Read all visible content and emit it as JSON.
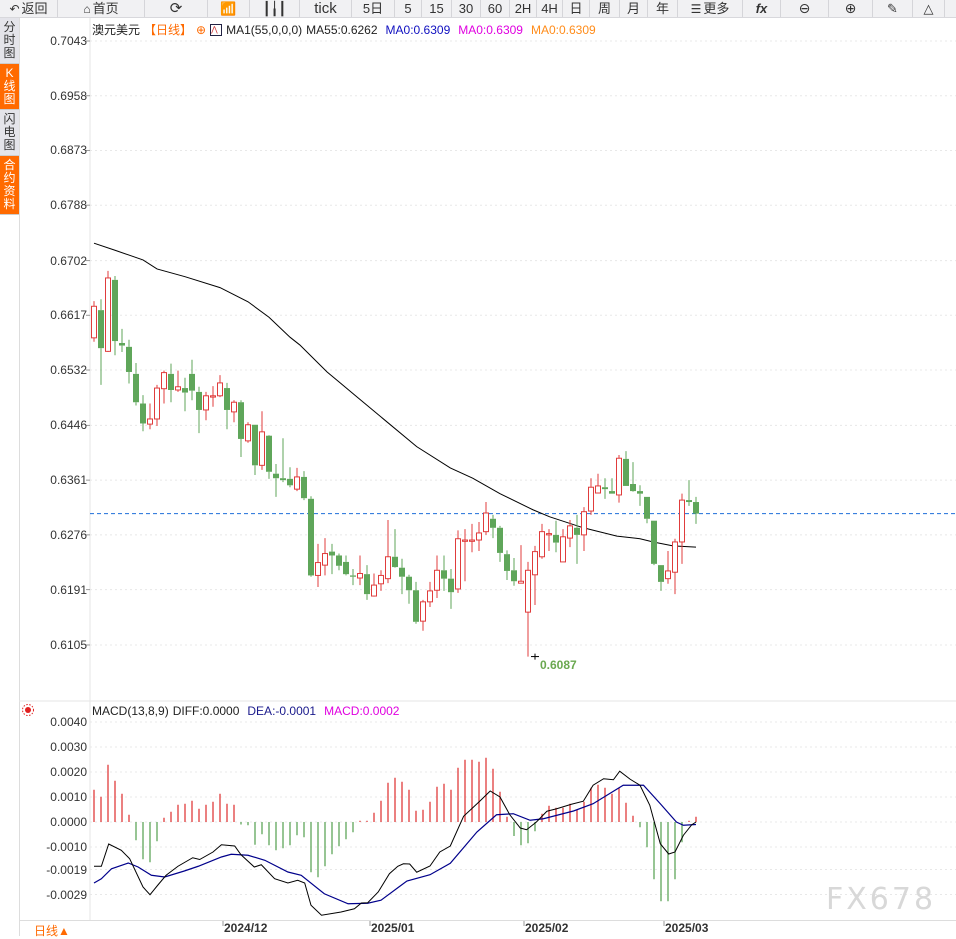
{
  "toolbar": {
    "back": "返回",
    "home": "首页",
    "tick": "tick",
    "five_day": "5日",
    "periods": [
      "5",
      "15",
      "30",
      "60",
      "2H",
      "4H",
      "日",
      "周",
      "月",
      "年"
    ],
    "more": "更多"
  },
  "sidebar": {
    "tabs": [
      "分时图",
      "K线图",
      "闪电图",
      "合约资料"
    ]
  },
  "legend": {
    "symbol": "澳元美元",
    "period": "【日线】",
    "ma_name": "MA1(55,0,0,0)",
    "ma55": "MA55:0.6262",
    "ma0_a": "MA0:0.6309",
    "ma0_b": "MA0:0.6309",
    "ma0_c": "MA0:0.6309"
  },
  "macd_legend": {
    "name": "MACD(13,8,9)",
    "diff": "DIFF:0.0000",
    "dea": "DEA:-0.0001",
    "macd": "MACD:0.0002"
  },
  "bottom": {
    "period": "日线▲"
  },
  "watermark": "FX678",
  "colors": {
    "up": "#e03c3c",
    "down": "#5fa65a",
    "accent": "#ff6a00",
    "dea": "#00008b",
    "macd_text": "#e000e0",
    "last_line": "#1e6fd9"
  },
  "chart_data": [
    {
      "type": "candlestick",
      "title": "澳元美元 日线",
      "y_ticks": [
        "0.7043",
        "0.6958",
        "0.6873",
        "0.6788",
        "0.6702",
        "0.6617",
        "0.6532",
        "0.6446",
        "0.6361",
        "0.6276",
        "0.6191",
        "0.6105"
      ],
      "ylim": [
        0.6105,
        0.7043
      ],
      "x_ticks": [
        {
          "label": "2024/12",
          "index": 19
        },
        {
          "label": "2025/01",
          "index": 40
        },
        {
          "label": "2025/02",
          "index": 62
        },
        {
          "label": "2025/03",
          "index": 82
        }
      ],
      "last_price": 0.6309,
      "low_marker": {
        "index": 63,
        "value": 0.6087,
        "label": "0.6087"
      },
      "candles_ohlc": [
        [
          0.6582,
          0.6639,
          0.6576,
          0.6631
        ],
        [
          0.6625,
          0.6642,
          0.6509,
          0.6566
        ],
        [
          0.6561,
          0.6686,
          0.656,
          0.6675
        ],
        [
          0.6672,
          0.6678,
          0.6555,
          0.6577
        ],
        [
          0.6574,
          0.6596,
          0.656,
          0.657
        ],
        [
          0.6568,
          0.6579,
          0.6511,
          0.6529
        ],
        [
          0.6526,
          0.6543,
          0.6477,
          0.6482
        ],
        [
          0.648,
          0.6493,
          0.6437,
          0.6449
        ],
        [
          0.6448,
          0.648,
          0.644,
          0.6456
        ],
        [
          0.6456,
          0.6509,
          0.6445,
          0.6504
        ],
        [
          0.6503,
          0.6531,
          0.648,
          0.6528
        ],
        [
          0.6526,
          0.6542,
          0.6482,
          0.6501
        ],
        [
          0.6501,
          0.6531,
          0.6498,
          0.6506
        ],
        [
          0.6504,
          0.652,
          0.6468,
          0.6497
        ],
        [
          0.6526,
          0.6548,
          0.6485,
          0.65
        ],
        [
          0.6498,
          0.6506,
          0.6434,
          0.647
        ],
        [
          0.647,
          0.6498,
          0.6454,
          0.6492
        ],
        [
          0.649,
          0.6507,
          0.6475,
          0.6492
        ],
        [
          0.6492,
          0.6524,
          0.649,
          0.6512
        ],
        [
          0.6504,
          0.6512,
          0.644,
          0.647
        ],
        [
          0.6467,
          0.6485,
          0.6451,
          0.6482
        ],
        [
          0.6482,
          0.6485,
          0.6397,
          0.6425
        ],
        [
          0.6422,
          0.6451,
          0.6419,
          0.6447
        ],
        [
          0.6447,
          0.6447,
          0.6369,
          0.6384
        ],
        [
          0.6384,
          0.6468,
          0.6377,
          0.6436
        ],
        [
          0.643,
          0.6431,
          0.6363,
          0.6374
        ],
        [
          0.6371,
          0.6386,
          0.6335,
          0.6364
        ],
        [
          0.6364,
          0.6426,
          0.6358,
          0.6361
        ],
        [
          0.6363,
          0.6381,
          0.635,
          0.6353
        ],
        [
          0.6347,
          0.638,
          0.6344,
          0.6366
        ],
        [
          0.6366,
          0.6375,
          0.633,
          0.6333
        ],
        [
          0.6332,
          0.6336,
          0.6211,
          0.6213
        ],
        [
          0.6213,
          0.6262,
          0.6195,
          0.6233
        ],
        [
          0.6229,
          0.6271,
          0.6213,
          0.6247
        ],
        [
          0.625,
          0.6262,
          0.6215,
          0.6244
        ],
        [
          0.6244,
          0.6247,
          0.6221,
          0.6228
        ],
        [
          0.6234,
          0.6244,
          0.6213,
          0.6215
        ],
        [
          0.6213,
          0.6223,
          0.6198,
          0.6211
        ],
        [
          0.6209,
          0.6244,
          0.6198,
          0.6216
        ],
        [
          0.6215,
          0.6229,
          0.6175,
          0.6184
        ],
        [
          0.6181,
          0.6216,
          0.618,
          0.6198
        ],
        [
          0.62,
          0.6221,
          0.6189,
          0.6213
        ],
        [
          0.6208,
          0.6299,
          0.6201,
          0.6242
        ],
        [
          0.6242,
          0.6285,
          0.6225,
          0.6226
        ],
        [
          0.6225,
          0.6239,
          0.6184,
          0.6211
        ],
        [
          0.6211,
          0.6214,
          0.6169,
          0.619
        ],
        [
          0.619,
          0.6203,
          0.6138,
          0.6141
        ],
        [
          0.6142,
          0.6175,
          0.6127,
          0.6172
        ],
        [
          0.6172,
          0.6203,
          0.6164,
          0.6189
        ],
        [
          0.619,
          0.6244,
          0.6178,
          0.6221
        ],
        [
          0.6221,
          0.6244,
          0.6189,
          0.6208
        ],
        [
          0.6208,
          0.6223,
          0.6161,
          0.6187
        ],
        [
          0.6192,
          0.6283,
          0.6186,
          0.627
        ],
        [
          0.6266,
          0.6285,
          0.6204,
          0.6268
        ],
        [
          0.6266,
          0.6293,
          0.6249,
          0.6268
        ],
        [
          0.6268,
          0.6296,
          0.6251,
          0.6279
        ],
        [
          0.6281,
          0.6327,
          0.6276,
          0.631
        ],
        [
          0.6301,
          0.6307,
          0.6271,
          0.6287
        ],
        [
          0.6287,
          0.629,
          0.6234,
          0.6248
        ],
        [
          0.6246,
          0.6252,
          0.6206,
          0.622
        ],
        [
          0.6221,
          0.624,
          0.6197,
          0.6204
        ],
        [
          0.6201,
          0.626,
          0.6201,
          0.6204
        ],
        [
          0.6156,
          0.6234,
          0.6087,
          0.6221
        ],
        [
          0.6214,
          0.6259,
          0.6167,
          0.625
        ],
        [
          0.6242,
          0.6293,
          0.6239,
          0.6281
        ],
        [
          0.6276,
          0.6285,
          0.6251,
          0.6278
        ],
        [
          0.6276,
          0.6298,
          0.6249,
          0.6264
        ],
        [
          0.6234,
          0.6285,
          0.6234,
          0.6273
        ],
        [
          0.6271,
          0.6299,
          0.6257,
          0.629
        ],
        [
          0.6287,
          0.6307,
          0.6231,
          0.6276
        ],
        [
          0.6276,
          0.6319,
          0.6251,
          0.6312
        ],
        [
          0.6313,
          0.6364,
          0.6307,
          0.635
        ],
        [
          0.6341,
          0.6371,
          0.6341,
          0.6352
        ],
        [
          0.635,
          0.6364,
          0.6332,
          0.6347
        ],
        [
          0.6344,
          0.6364,
          0.634,
          0.634
        ],
        [
          0.6338,
          0.64,
          0.6326,
          0.6395
        ],
        [
          0.6394,
          0.6406,
          0.6352,
          0.6352
        ],
        [
          0.6355,
          0.6389,
          0.6343,
          0.6344
        ],
        [
          0.6344,
          0.6353,
          0.6321,
          0.634
        ],
        [
          0.6335,
          0.6335,
          0.6294,
          0.6301
        ],
        [
          0.6298,
          0.6298,
          0.6229,
          0.6231
        ],
        [
          0.6229,
          0.6229,
          0.6189,
          0.6203
        ],
        [
          0.6208,
          0.6251,
          0.62,
          0.622
        ],
        [
          0.6218,
          0.627,
          0.6184,
          0.6265
        ],
        [
          0.6265,
          0.634,
          0.6231,
          0.633
        ],
        [
          0.633,
          0.6361,
          0.6321,
          0.6327
        ],
        [
          0.6327,
          0.6335,
          0.6293,
          0.6309
        ]
      ],
      "ma55": [
        [
          0,
          0.6729
        ],
        [
          3,
          0.6718
        ],
        [
          7,
          0.6703
        ],
        [
          9,
          0.6689
        ],
        [
          13,
          0.6677
        ],
        [
          18,
          0.666
        ],
        [
          22,
          0.6638
        ],
        [
          25,
          0.6614
        ],
        [
          28,
          0.6583
        ],
        [
          29.4,
          0.6571
        ],
        [
          33.3,
          0.6529
        ],
        [
          37.6,
          0.649
        ],
        [
          41.9,
          0.6451
        ],
        [
          46.1,
          0.6413
        ],
        [
          50.9,
          0.638
        ],
        [
          54.1,
          0.6364
        ],
        [
          58,
          0.634
        ],
        [
          62.7,
          0.6315
        ],
        [
          65.1,
          0.6304
        ],
        [
          69.9,
          0.6287
        ],
        [
          74.7,
          0.6274
        ],
        [
          78,
          0.627
        ],
        [
          79.9,
          0.6265
        ],
        [
          82.7,
          0.6259
        ],
        [
          86,
          0.6257
        ]
      ]
    },
    {
      "type": "macd",
      "y_ticks": [
        "0.0040",
        "0.0030",
        "0.0020",
        "0.0010",
        "0.0000",
        "-0.0010",
        "-0.0019",
        "-0.0029"
      ],
      "ylim": [
        -0.0036,
        0.004
      ],
      "histogram": [
        0.00129,
        0.00101,
        0.00229,
        0.00165,
        0.00113,
        0.00029,
        -0.00073,
        -0.00149,
        -0.00161,
        -0.00077,
        0.00017,
        0.00041,
        0.00069,
        0.00073,
        0.00085,
        0.00053,
        0.00069,
        0.00081,
        0.00113,
        0.00073,
        0.00069,
        -0.0001,
        -0.00013,
        -0.00091,
        -0.00049,
        -0.00093,
        -0.00113,
        -0.00105,
        -0.00093,
        -0.00053,
        -0.00061,
        -0.00201,
        -0.00221,
        -0.00177,
        -0.00129,
        -0.00097,
        -0.00069,
        -0.00041,
        5e-05,
        5e-05,
        0.00037,
        0.00085,
        0.00157,
        0.00177,
        0.00161,
        0.00129,
        0.00045,
        0.00049,
        0.00081,
        0.00141,
        0.00153,
        0.00129,
        0.00217,
        0.00249,
        0.00249,
        0.00241,
        0.00257,
        0.00213,
        0.00121,
        0.00021,
        -0.00056,
        -0.00093,
        -0.00085,
        -0.00037,
        0.00033,
        0.00065,
        0.00057,
        0.00057,
        0.00073,
        0.00049,
        0.00081,
        0.00137,
        0.00149,
        0.00137,
        0.00113,
        0.00137,
        0.00077,
        0.00025,
        -0.00021,
        -0.00101,
        -0.00229,
        -0.00317,
        -0.00317,
        -0.00229,
        -0.00081,
        5e-05,
        0.00021
      ],
      "diff": [
        [
          0,
          -0.00177
        ],
        [
          1.05,
          -0.00177
        ],
        [
          2.1,
          -0.00088
        ],
        [
          3.9,
          -0.00113
        ],
        [
          5.1,
          -0.00147
        ],
        [
          7,
          -0.0026
        ],
        [
          8,
          -0.00291
        ],
        [
          9.1,
          -0.00253
        ],
        [
          10.3,
          -0.00213
        ],
        [
          12,
          -0.00177
        ],
        [
          14.1,
          -0.00143
        ],
        [
          15.1,
          -0.0015
        ],
        [
          17,
          -0.0012
        ],
        [
          18.2,
          -0.00091
        ],
        [
          20.1,
          -0.00096
        ],
        [
          21,
          -0.00131
        ],
        [
          22.9,
          -0.0018
        ],
        [
          23.9,
          -0.00171
        ],
        [
          25.8,
          -0.00227
        ],
        [
          27.7,
          -0.00244
        ],
        [
          29.1,
          -0.00233
        ],
        [
          30.1,
          -0.00244
        ],
        [
          31,
          -0.00333
        ],
        [
          32.5,
          -0.00373
        ],
        [
          35.3,
          -0.0036
        ],
        [
          37.2,
          -0.00347
        ],
        [
          38.2,
          -0.00324
        ],
        [
          39.1,
          -0.00323
        ],
        [
          40.6,
          -0.0028
        ],
        [
          42.2,
          -0.00207
        ],
        [
          43.4,
          -0.00177
        ],
        [
          44.2,
          -0.00167
        ],
        [
          45.1,
          -0.00168
        ],
        [
          46.1,
          -0.00201
        ],
        [
          48,
          -0.00176
        ],
        [
          49.4,
          -0.0012
        ],
        [
          50.9,
          -0.00096
        ],
        [
          52.8,
          0.00023
        ],
        [
          55.1,
          0.00083
        ],
        [
          56.6,
          0.00124
        ],
        [
          58,
          0.001
        ],
        [
          59.4,
          0.00029
        ],
        [
          60.9,
          -0.00024
        ],
        [
          61.8,
          -0.00031
        ],
        [
          63.2,
          0
        ],
        [
          64.7,
          0.00043
        ],
        [
          66.1,
          0.00053
        ],
        [
          68.2,
          0.00071
        ],
        [
          69.9,
          0.00083
        ],
        [
          71.3,
          0.00147
        ],
        [
          72.8,
          0.00173
        ],
        [
          74.2,
          0.00169
        ],
        [
          75.1,
          0.00203
        ],
        [
          76.6,
          0.00171
        ],
        [
          78,
          0.00147
        ],
        [
          79.4,
          0.00067
        ],
        [
          80.9,
          -0.00087
        ],
        [
          82.1,
          -0.00128
        ],
        [
          83,
          -0.0012
        ],
        [
          84.2,
          -0.00053
        ],
        [
          85.4,
          -0.00011
        ],
        [
          86,
          0
        ]
      ],
      "dea": [
        [
          0,
          -0.00244
        ],
        [
          1.05,
          -0.00227
        ],
        [
          2.5,
          -0.00187
        ],
        [
          4.9,
          -0.00164
        ],
        [
          6.3,
          -0.0018
        ],
        [
          8.2,
          -0.00213
        ],
        [
          10.1,
          -0.0022
        ],
        [
          12.9,
          -0.00196
        ],
        [
          14.9,
          -0.00177
        ],
        [
          18.2,
          -0.0014
        ],
        [
          19.6,
          -0.00129
        ],
        [
          22,
          -0.00133
        ],
        [
          24.4,
          -0.00153
        ],
        [
          27.7,
          -0.002
        ],
        [
          29.6,
          -0.00213
        ],
        [
          32.9,
          -0.00287
        ],
        [
          36.3,
          -0.00327
        ],
        [
          39.1,
          -0.00325
        ],
        [
          41,
          -0.00313
        ],
        [
          43.4,
          -0.00263
        ],
        [
          44.7,
          -0.00236
        ],
        [
          48,
          -0.00211
        ],
        [
          50.9,
          -0.00165
        ],
        [
          54.7,
          -0.0004
        ],
        [
          57.5,
          0.00029
        ],
        [
          59.9,
          0.00033
        ],
        [
          62.3,
          7e-05
        ],
        [
          64.2,
          0.00013
        ],
        [
          68.5,
          0.00044
        ],
        [
          71.3,
          0.00073
        ],
        [
          75.6,
          0.00147
        ],
        [
          78.5,
          0.00147
        ],
        [
          80.9,
          0.00073
        ],
        [
          83.2,
          0
        ],
        [
          84.2,
          -0.00013
        ],
        [
          86,
          -0.0001
        ]
      ]
    }
  ]
}
